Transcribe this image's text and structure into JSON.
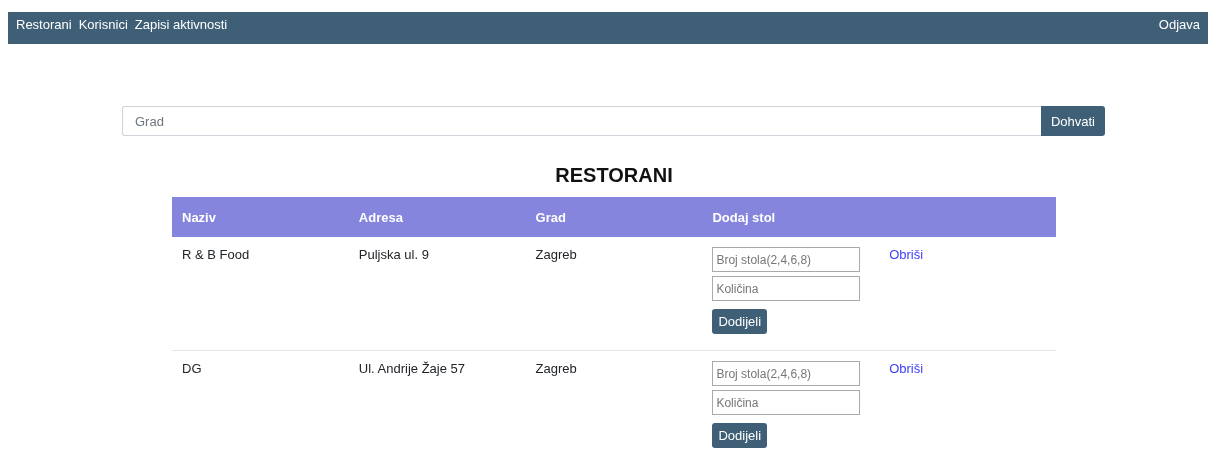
{
  "navbar": {
    "links": [
      "Restorani",
      "Korisnici",
      "Zapisi aktivnosti"
    ],
    "logout": "Odjava"
  },
  "search": {
    "placeholder": "Grad",
    "button": "Dohvati"
  },
  "title": "RESTORANI",
  "table": {
    "columns": [
      "Naziv",
      "Adresa",
      "Grad",
      "Dodaj stol"
    ],
    "rows": [
      {
        "naziv": "R & B Food",
        "adresa": "Puljska ul. 9",
        "grad": "Zagreb",
        "table_placeholder": "Broj stola(2,4,6,8)",
        "quantity_placeholder": "Količina",
        "assign_button": "Dodijeli",
        "delete_link": "Obriši"
      },
      {
        "naziv": "DG",
        "adresa": "Ul. Andrije Žaje 57",
        "grad": "Zagreb",
        "table_placeholder": "Broj stola(2,4,6,8)",
        "quantity_placeholder": "Količina",
        "assign_button": "Dodijeli",
        "delete_link": "Obriši"
      }
    ]
  }
}
